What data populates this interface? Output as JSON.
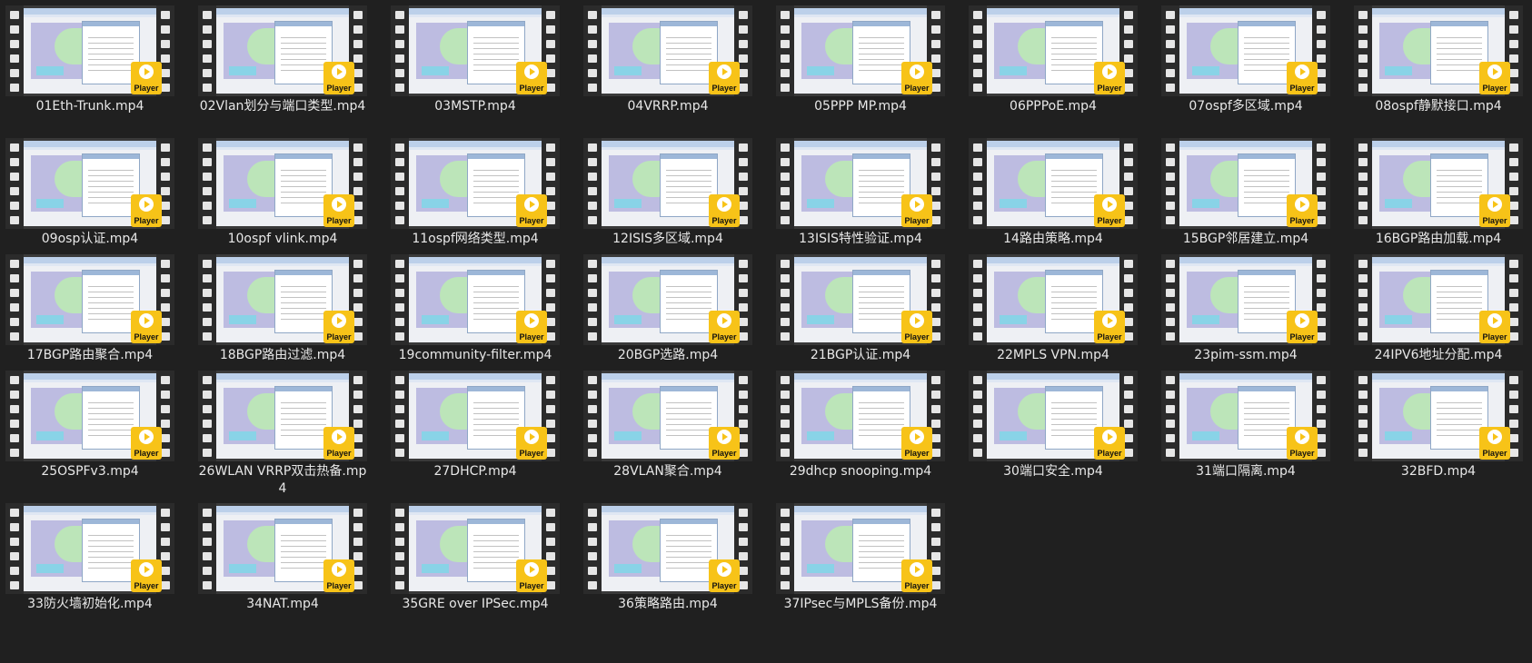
{
  "badge_label": "Player",
  "colors": {
    "background": "#202020",
    "label_text": "#e8e8e8",
    "badge": "#f7c318"
  },
  "files": [
    {
      "name": "01Eth-Trunk.mp4",
      "icon": "video-thumbnail"
    },
    {
      "name": "02Vlan划分与端口类型.mp4",
      "icon": "video-thumbnail"
    },
    {
      "name": "03MSTP.mp4",
      "icon": "video-thumbnail"
    },
    {
      "name": "04VRRP.mp4",
      "icon": "video-thumbnail"
    },
    {
      "name": "05PPP MP.mp4",
      "icon": "video-thumbnail"
    },
    {
      "name": "06PPPoE.mp4",
      "icon": "video-thumbnail"
    },
    {
      "name": "07ospf多区域.mp4",
      "icon": "video-thumbnail"
    },
    {
      "name": "08ospf静默接口.mp4",
      "icon": "video-thumbnail"
    },
    {
      "name": "09osp认证.mp4",
      "icon": "video-thumbnail"
    },
    {
      "name": "10ospf vlink.mp4",
      "icon": "video-thumbnail"
    },
    {
      "name": "11ospf网络类型.mp4",
      "icon": "video-thumbnail"
    },
    {
      "name": "12ISIS多区域.mp4",
      "icon": "video-thumbnail"
    },
    {
      "name": "13ISIS特性验证.mp4",
      "icon": "video-thumbnail"
    },
    {
      "name": "14路由策略.mp4",
      "icon": "video-thumbnail"
    },
    {
      "name": "15BGP邻居建立.mp4",
      "icon": "video-thumbnail"
    },
    {
      "name": "16BGP路由加载.mp4",
      "icon": "video-thumbnail"
    },
    {
      "name": "17BGP路由聚合.mp4",
      "icon": "video-thumbnail"
    },
    {
      "name": "18BGP路由过滤.mp4",
      "icon": "video-thumbnail"
    },
    {
      "name": "19community-filter.mp4",
      "icon": "video-thumbnail"
    },
    {
      "name": "20BGP选路.mp4",
      "icon": "video-thumbnail"
    },
    {
      "name": "21BGP认证.mp4",
      "icon": "video-thumbnail"
    },
    {
      "name": "22MPLS VPN.mp4",
      "icon": "video-thumbnail"
    },
    {
      "name": "23pim-ssm.mp4",
      "icon": "video-thumbnail"
    },
    {
      "name": "24IPV6地址分配.mp4",
      "icon": "video-thumbnail"
    },
    {
      "name": "25OSPFv3.mp4",
      "icon": "video-thumbnail"
    },
    {
      "name": "26WLAN VRRP双击热备.mp4",
      "icon": "video-thumbnail"
    },
    {
      "name": "27DHCP.mp4",
      "icon": "video-thumbnail"
    },
    {
      "name": "28VLAN聚合.mp4",
      "icon": "video-thumbnail"
    },
    {
      "name": "29dhcp snooping.mp4",
      "icon": "video-thumbnail"
    },
    {
      "name": "30端口安全.mp4",
      "icon": "video-thumbnail"
    },
    {
      "name": "31端口隔离.mp4",
      "icon": "video-thumbnail"
    },
    {
      "name": "32BFD.mp4",
      "icon": "video-thumbnail"
    },
    {
      "name": "33防火墙初始化.mp4",
      "icon": "video-thumbnail"
    },
    {
      "name": "34NAT.mp4",
      "icon": "video-thumbnail"
    },
    {
      "name": "35GRE over IPSec.mp4",
      "icon": "video-thumbnail"
    },
    {
      "name": "36策略路由.mp4",
      "icon": "video-thumbnail"
    },
    {
      "name": "37IPsec与MPLS备份.mp4",
      "icon": "video-thumbnail"
    }
  ]
}
